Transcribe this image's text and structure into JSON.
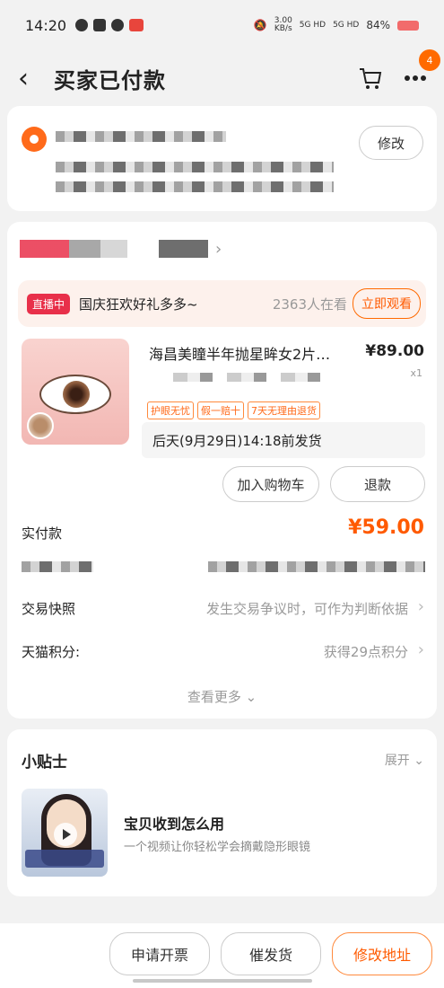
{
  "status_bar": {
    "time": "14:20",
    "net_speed": "3.00",
    "net_unit": "KB/s",
    "sig1": "5G HD",
    "sig2": "5G HD",
    "battery": "84%"
  },
  "nav": {
    "title": "买家已付款",
    "badge_count": "4"
  },
  "address": {
    "edit_label": "修改"
  },
  "live": {
    "tag": "直播中",
    "text": "国庆狂欢好礼多多~",
    "viewers": "2363人在看",
    "watch_label": "立即观看"
  },
  "product": {
    "title": "海昌美瞳半年抛星眸女2片…",
    "price": "¥89.00",
    "qty": "x1",
    "tags": [
      "护眼无忧",
      "假一赔十",
      "7天无理由退货"
    ],
    "ship_text": "后天(9月29日)14:18前发货",
    "add_cart_label": "加入购物车",
    "refund_label": "退款"
  },
  "payment": {
    "label": "实付款",
    "amount": "¥59.00"
  },
  "rows": {
    "snapshot_label": "交易快照",
    "snapshot_value": "发生交易争议时，可作为判断依据",
    "points_label": "天猫积分:",
    "points_value": "获得29点积分",
    "more_label": "查看更多"
  },
  "tips": {
    "title": "小贴士",
    "expand_label": "展开",
    "item_title": "宝贝收到怎么用",
    "item_desc": "一个视频让你轻松学会摘戴隐形眼镜"
  },
  "bottom": {
    "invoice_label": "申请开票",
    "urge_label": "催发货",
    "edit_addr_label": "修改地址"
  }
}
